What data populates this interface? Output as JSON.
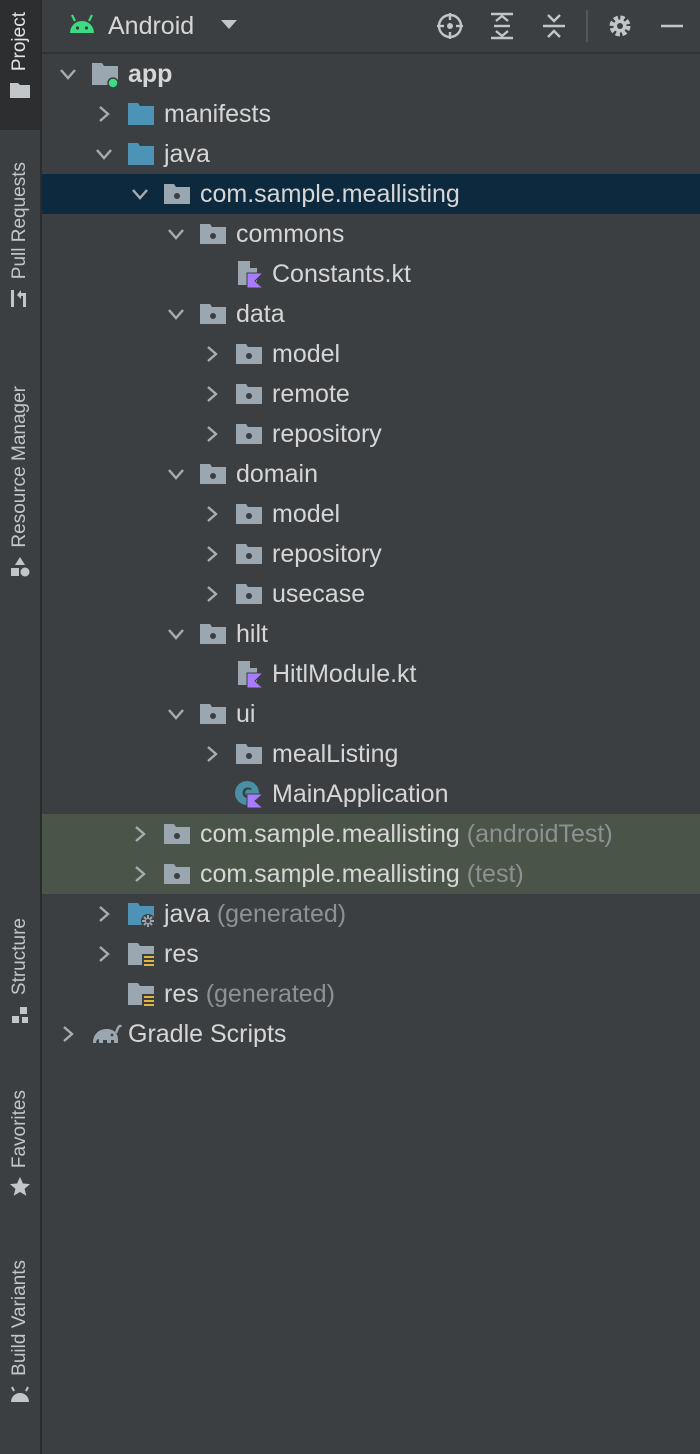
{
  "toolbar": {
    "view_label": "Android",
    "icons": [
      "android-icon",
      "dropdown-arrow-icon",
      "locate-icon",
      "expand-all-icon",
      "collapse-all-icon",
      "settings-gear-icon",
      "hide-minimize-icon"
    ]
  },
  "left_strip": {
    "tabs": [
      {
        "label": "Project",
        "icon": "folder-icon",
        "active": true
      },
      {
        "label": "Pull Requests",
        "icon": "pull-request-icon",
        "active": false
      },
      {
        "label": "Resource Manager",
        "icon": "resource-shapes-icon",
        "active": false
      },
      {
        "label": "Structure",
        "icon": "structure-icon",
        "active": false
      },
      {
        "label": "Favorites",
        "icon": "star-icon",
        "active": false
      },
      {
        "label": "Build Variants",
        "icon": "android-icon",
        "active": false
      }
    ]
  },
  "tree": [
    {
      "name": "app",
      "suffix": "",
      "depth": 0,
      "chevron": "down",
      "icon": "module-folder-icon",
      "bold": true
    },
    {
      "name": "manifests",
      "suffix": "",
      "depth": 1,
      "chevron": "right",
      "icon": "folder-icon"
    },
    {
      "name": "java",
      "suffix": "",
      "depth": 1,
      "chevron": "down",
      "icon": "folder-icon"
    },
    {
      "name": "com.sample.meallisting",
      "suffix": "",
      "depth": 2,
      "chevron": "down",
      "icon": "package-icon",
      "state": "selected"
    },
    {
      "name": "commons",
      "suffix": "",
      "depth": 3,
      "chevron": "down",
      "icon": "package-icon"
    },
    {
      "name": "Constants.kt",
      "suffix": "",
      "depth": 4,
      "chevron": "none",
      "icon": "kotlin-file-icon"
    },
    {
      "name": "data",
      "suffix": "",
      "depth": 3,
      "chevron": "down",
      "icon": "package-icon"
    },
    {
      "name": "model",
      "suffix": "",
      "depth": 4,
      "chevron": "right",
      "icon": "package-icon"
    },
    {
      "name": "remote",
      "suffix": "",
      "depth": 4,
      "chevron": "right",
      "icon": "package-icon"
    },
    {
      "name": "repository",
      "suffix": "",
      "depth": 4,
      "chevron": "right",
      "icon": "package-icon"
    },
    {
      "name": "domain",
      "suffix": "",
      "depth": 3,
      "chevron": "down",
      "icon": "package-icon"
    },
    {
      "name": "model",
      "suffix": "",
      "depth": 4,
      "chevron": "right",
      "icon": "package-icon"
    },
    {
      "name": "repository",
      "suffix": "",
      "depth": 4,
      "chevron": "right",
      "icon": "package-icon"
    },
    {
      "name": "usecase",
      "suffix": "",
      "depth": 4,
      "chevron": "right",
      "icon": "package-icon"
    },
    {
      "name": "hilt",
      "suffix": "",
      "depth": 3,
      "chevron": "down",
      "icon": "package-icon"
    },
    {
      "name": "HitlModule.kt",
      "suffix": "",
      "depth": 4,
      "chevron": "none",
      "icon": "kotlin-file-icon"
    },
    {
      "name": "ui",
      "suffix": "",
      "depth": 3,
      "chevron": "down",
      "icon": "package-icon"
    },
    {
      "name": "mealListing",
      "suffix": "",
      "depth": 4,
      "chevron": "right",
      "icon": "package-icon"
    },
    {
      "name": "MainApplication",
      "suffix": "",
      "depth": 4,
      "chevron": "none",
      "icon": "kotlin-class-icon"
    },
    {
      "name": "com.sample.meallisting",
      "suffix": "(androidTest)",
      "depth": 2,
      "chevron": "right",
      "icon": "package-icon",
      "state": "test"
    },
    {
      "name": "com.sample.meallisting",
      "suffix": "(test)",
      "depth": 2,
      "chevron": "right",
      "icon": "package-icon",
      "state": "test"
    },
    {
      "name": "java",
      "suffix": "(generated)",
      "depth": 1,
      "chevron": "right",
      "icon": "generated-folder-icon"
    },
    {
      "name": "res",
      "suffix": "",
      "depth": 1,
      "chevron": "right",
      "icon": "resource-folder-icon"
    },
    {
      "name": "res",
      "suffix": "(generated)",
      "depth": 1,
      "chevron": "none",
      "icon": "resource-folder-icon"
    },
    {
      "name": "Gradle Scripts",
      "suffix": "",
      "depth": 0,
      "chevron": "right",
      "icon": "gradle-elephant-icon"
    }
  ],
  "colors": {
    "background": "#3c3f41",
    "selection": "#0d293e",
    "test_source_row": "#4b5449",
    "text": "#d6d6d6",
    "muted_text": "#8e9092",
    "folder_blue": "#4c93b5",
    "package_gray": "#9aa7b0",
    "kotlin_purple": "#a97bff",
    "android_green": "#3ddc84"
  }
}
